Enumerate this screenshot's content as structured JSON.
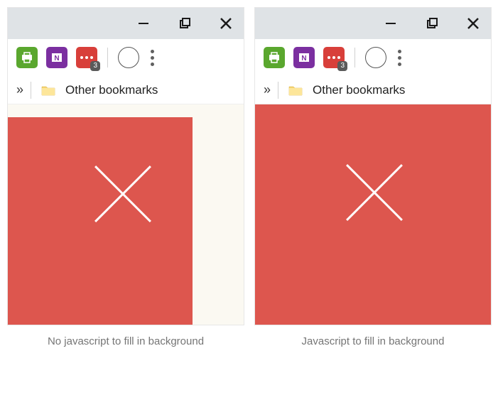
{
  "left": {
    "caption": "No javascript to fill in background",
    "bookmarks_label": "Other bookmarks",
    "ext_badge": "3"
  },
  "right": {
    "caption": "Javascript to fill in background",
    "bookmarks_label": "Other bookmarks",
    "ext_badge": "3"
  }
}
